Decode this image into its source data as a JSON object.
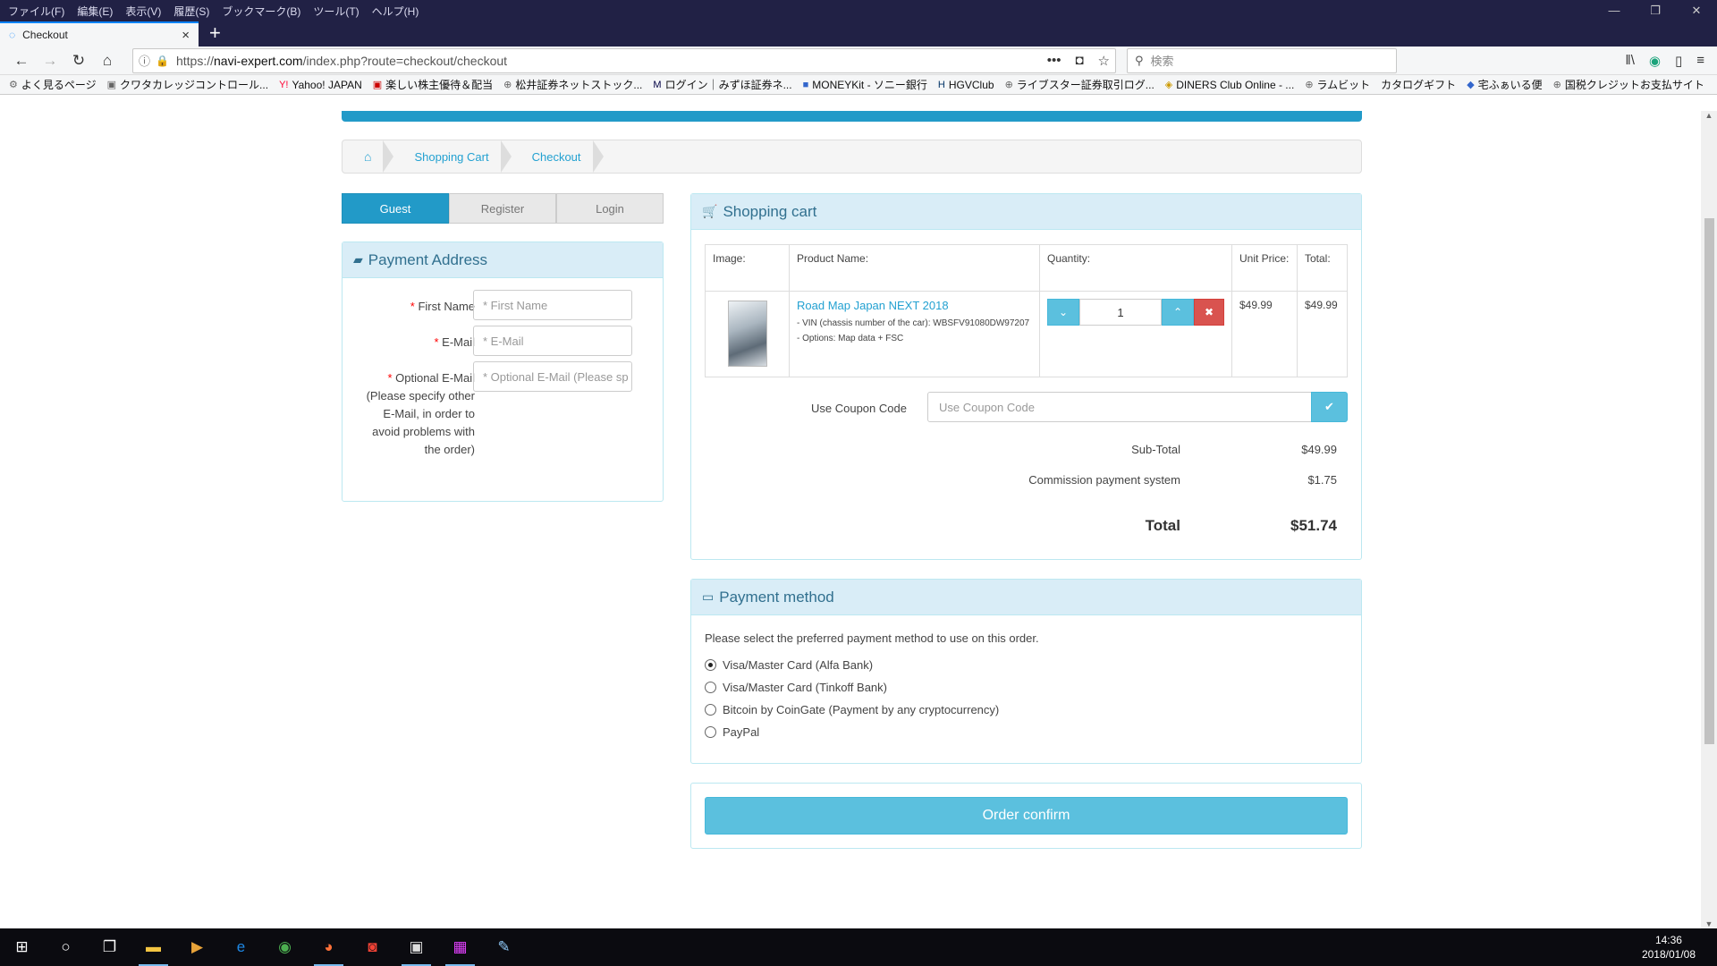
{
  "menubar": [
    "ファイル(F)",
    "編集(E)",
    "表示(V)",
    "履歴(S)",
    "ブックマーク(B)",
    "ツール(T)",
    "ヘルプ(H)"
  ],
  "tab": {
    "title": "Checkout"
  },
  "url": {
    "prefix": "https://",
    "domain": "navi-expert.com",
    "path": "/index.php?route=checkout/checkout"
  },
  "search": {
    "placeholder": "検索"
  },
  "bookmarks": [
    "よく見るページ",
    "クワタカレッジコントロール...",
    "Yahoo! JAPAN",
    "楽しい株主優待＆配当",
    "松井証券ネットストック...",
    "ログイン｜みずほ証券ネ...",
    "MONEYKit - ソニー銀行",
    "HGVClub",
    "ライブスター証券取引ログ...",
    "DINERS Club Online - ...",
    "ラムビット",
    "カタログギフト",
    "宅ふぁいる便",
    "国税クレジットお支払サイト"
  ],
  "breadcrumb": [
    "Shopping Cart",
    "Checkout"
  ],
  "account_tabs": [
    "Guest",
    "Register",
    "Login"
  ],
  "payment_address": {
    "title": "Payment Address",
    "fields": [
      {
        "label": "First Name",
        "placeholder": "* First Name"
      },
      {
        "label": "E-Mail",
        "placeholder": "* E-Mail"
      },
      {
        "label": "Optional E-Mail (Please specify other E-Mail, in order to avoid problems with the order)",
        "placeholder": "* Optional E-Mail (Please sp"
      }
    ]
  },
  "cart": {
    "title": "Shopping cart",
    "headers": [
      "Image:",
      "Product Name:",
      "Quantity:",
      "Unit Price:",
      "Total:"
    ],
    "item": {
      "name": "Road Map Japan NEXT 2018",
      "option1": "- VIN (chassis number of the car): WBSFV91080DW97207",
      "option2": "- Options: Map data + FSC",
      "quantity": "1",
      "unit_price": "$49.99",
      "total": "$49.99"
    },
    "coupon_label": "Use Coupon Code",
    "coupon_placeholder": "Use Coupon Code",
    "subtotal_label": "Sub-Total",
    "subtotal": "$49.99",
    "commission_label": "Commission payment system",
    "commission": "$1.75",
    "total_label": "Total",
    "total": "$51.74"
  },
  "payment": {
    "title": "Payment method",
    "text": "Please select the preferred payment method to use on this order.",
    "options": [
      "Visa/Master Card (Alfa Bank)",
      "Visa/Master Card (Tinkoff Bank)",
      "Bitcoin by CoinGate (Payment by any cryptocurrency)",
      "PayPal"
    ],
    "selected": 0
  },
  "confirm_label": "Order confirm",
  "clock": {
    "time": "14:36",
    "date": "2018/01/08"
  },
  "colors": {
    "accent": "#229ac8",
    "button": "#5bc0de",
    "danger": "#d9534f",
    "panel_head": "#d9edf7",
    "titlebar": "#212145"
  }
}
